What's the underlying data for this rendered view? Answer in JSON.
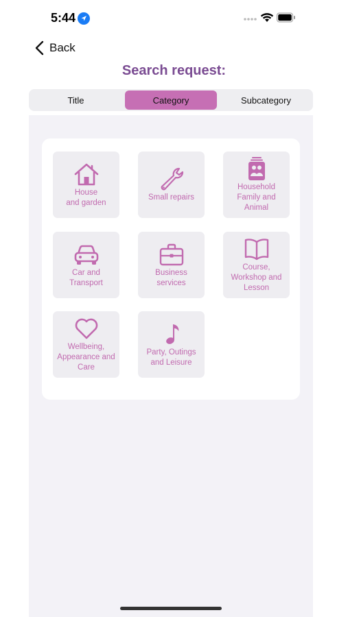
{
  "status_bar": {
    "time": "5:44"
  },
  "nav": {
    "back_label": "Back"
  },
  "page": {
    "title": "Search request:"
  },
  "segments": [
    {
      "label": "Title",
      "active": false
    },
    {
      "label": "Category",
      "active": true
    },
    {
      "label": "Subcategory",
      "active": false
    }
  ],
  "categories": [
    {
      "label": "House\nand garden",
      "icon": "house-icon"
    },
    {
      "label": "Small repairs",
      "icon": "wrench-icon"
    },
    {
      "label": "Household\nFamily and\nAnimal",
      "icon": "family-photo-icon"
    },
    {
      "label": "Car and\nTransport",
      "icon": "car-icon"
    },
    {
      "label": "Business\nservices",
      "icon": "briefcase-icon"
    },
    {
      "label": "Course,\nWorkshop and\nLesson",
      "icon": "book-icon"
    },
    {
      "label": "Wellbeing,\nAppearance and\nCare",
      "icon": "heart-icon"
    },
    {
      "label": "Party, Outings\nand Leisure",
      "icon": "music-note-icon"
    }
  ],
  "colors": {
    "accent": "#c16aaf",
    "title": "#7a4b92",
    "segment_active": "#c66fb4",
    "tile_bg": "#eeedf1"
  }
}
